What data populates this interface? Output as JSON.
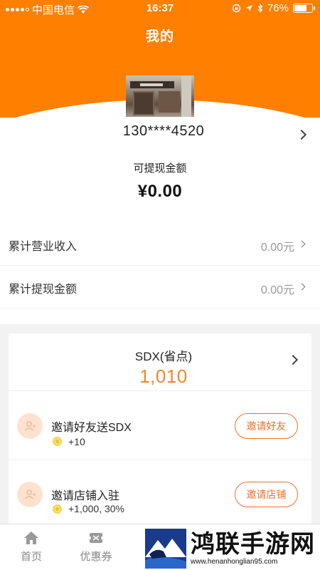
{
  "status_bar": {
    "carrier": "中国电信",
    "time": "16:37",
    "battery": "76%",
    "battery_level": 0.76
  },
  "header": {
    "title": "我的"
  },
  "profile": {
    "phone": "130****4520"
  },
  "balance": {
    "label": "可提现金额",
    "value": "¥0.00"
  },
  "stats": [
    {
      "label": "累计营业收入",
      "value": "0.00元"
    },
    {
      "label": "累计提现金额",
      "value": "0.00元"
    }
  ],
  "sdx": {
    "label": "SDX(省点)",
    "value": "1,010"
  },
  "tasks": [
    {
      "title": "邀请好友送SDX",
      "reward": "+10",
      "button": "邀请好友"
    },
    {
      "title": "邀请店铺入驻",
      "reward": "+1,000, 30%",
      "button": "邀请店铺"
    }
  ],
  "nav": {
    "home": "首页",
    "coupon": "优惠券"
  },
  "watermark": {
    "title": "鸿联手游网",
    "url": "www.henanhonglian95.com"
  },
  "colors": {
    "brand": "#ff7f00",
    "accent_text": "#f08a26",
    "button": "#f0702c"
  }
}
